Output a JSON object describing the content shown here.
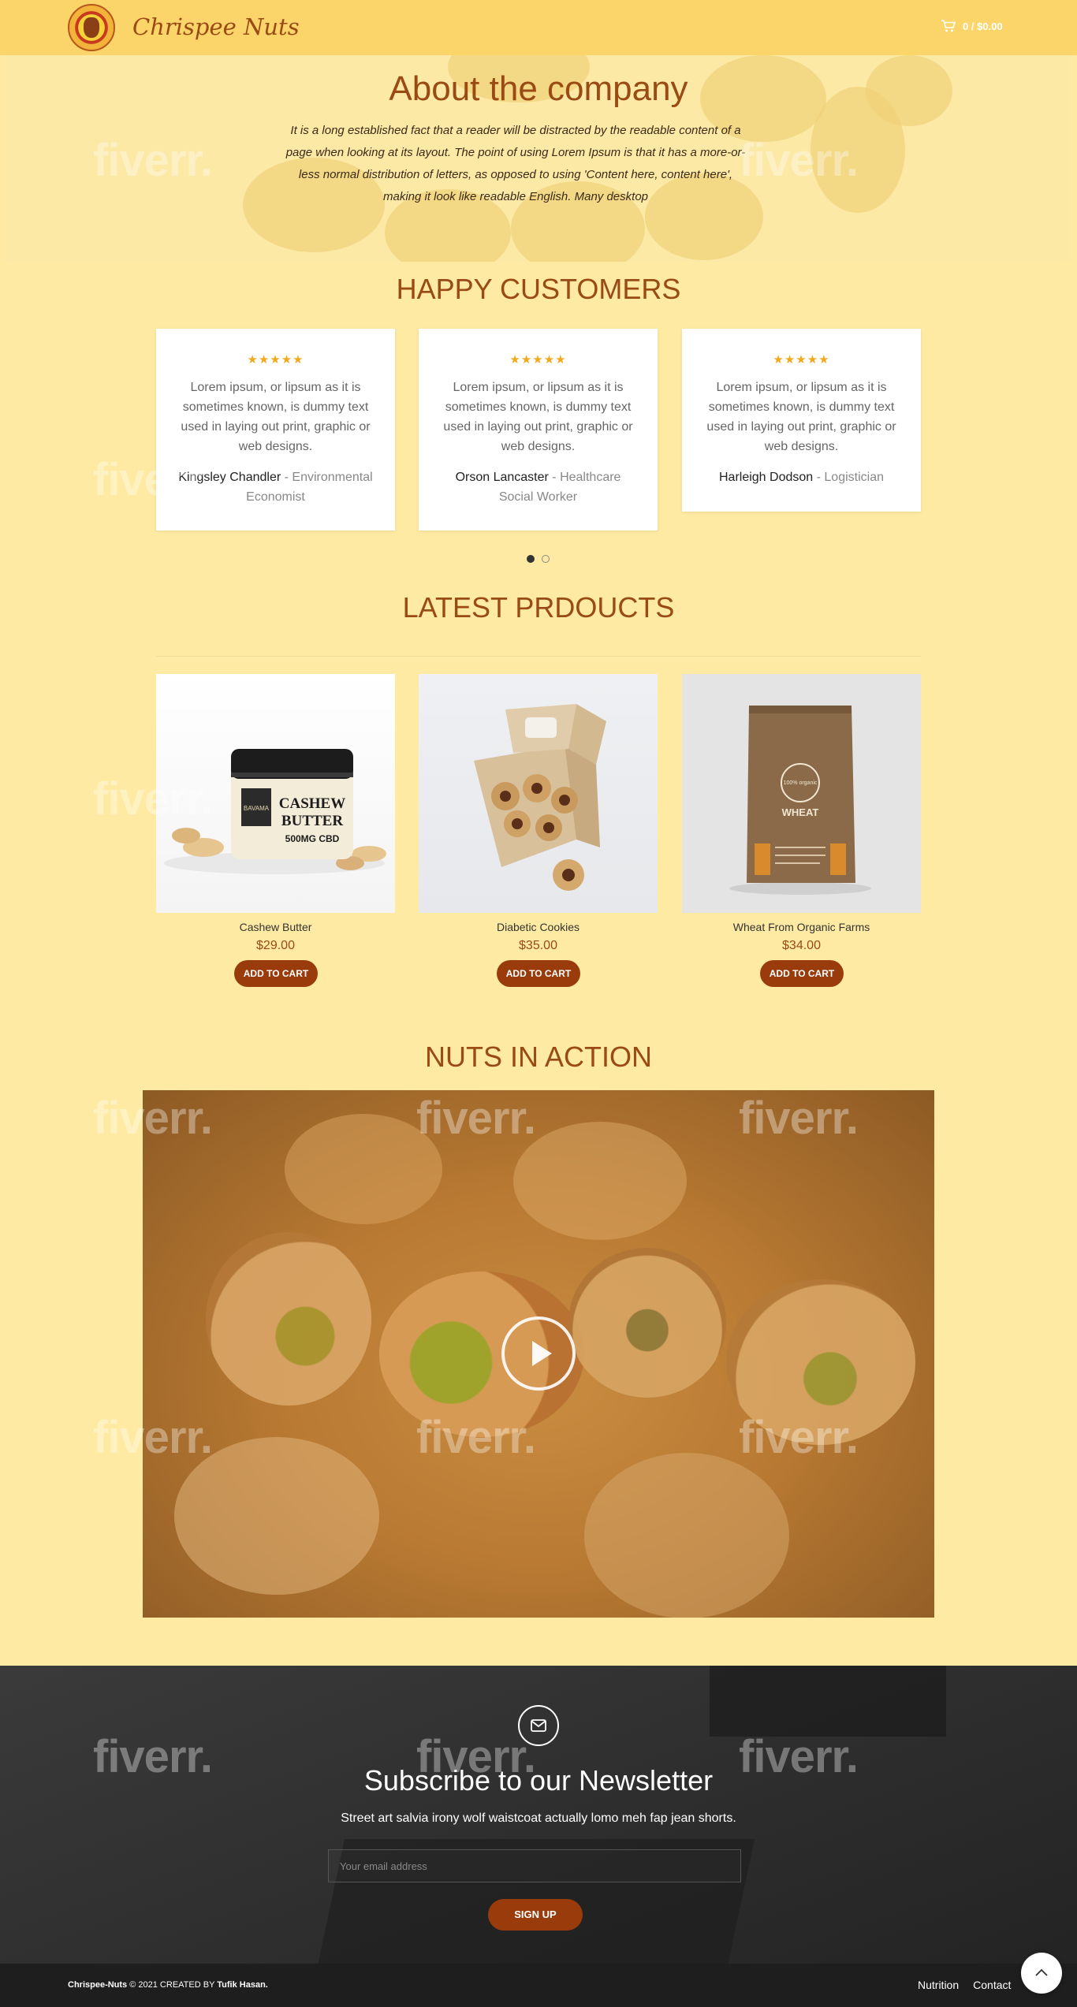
{
  "header": {
    "brand": "Chrispee Nuts",
    "cart_text": "0 / $0.00"
  },
  "about": {
    "title": "About the company",
    "text": "It is a long established fact that a reader will be distracted by the readable content of a page when looking at its layout. The point of using Lorem Ipsum is that it has a more-or-less normal distribution of letters, as opposed to using 'Content here, content here', making it look like readable English. Many desktop"
  },
  "testimonials": {
    "title": "HAPPY CUSTOMERS",
    "items": [
      {
        "stars": "★★★★★",
        "quote": "Lorem ipsum, or lipsum as it is sometimes known, is dummy text used in laying out print, graphic or web designs.",
        "name": "Kingsley Chandler",
        "role": "Environmental Economist"
      },
      {
        "stars": "★★★★★",
        "quote": "Lorem ipsum, or lipsum as it is sometimes known, is dummy text used in laying out print, graphic or web designs.",
        "name": "Orson Lancaster",
        "role": "Healthcare Social Worker"
      },
      {
        "stars": "★★★★★",
        "quote": "Lorem ipsum, or lipsum as it is sometimes known, is dummy text used in laying out print, graphic or web designs.",
        "name": "Harleigh Dodson",
        "role": "Logistician"
      }
    ]
  },
  "products": {
    "title": "LATEST PRDOUCTS",
    "items": [
      {
        "name": "Cashew Butter",
        "price": "$29.00",
        "button": "ADD TO CART",
        "jar_line1": "CASHEW",
        "jar_line2": "BUTTER",
        "jar_line3": "500MG CBD",
        "jar_brand": "BAVAMA"
      },
      {
        "name": "Diabetic Cookies",
        "price": "$35.00",
        "button": "ADD TO CART"
      },
      {
        "name": "Wheat From Organic Farms",
        "price": "$34.00",
        "button": "ADD TO CART",
        "bag_label": "WHEAT",
        "bag_badge": "100% organic"
      }
    ]
  },
  "video": {
    "title": "NUTS IN ACTION"
  },
  "newsletter": {
    "title": "Subscribe to our Newsletter",
    "subtitle": "Street art salvia irony wolf waistcoat actually lomo meh fap jean shorts.",
    "email_placeholder": "Your email address",
    "button": "SIGN UP"
  },
  "footer": {
    "brand": "Chrispee-Nuts",
    "copy": " © 2021 CREATED BY ",
    "author": "Tufik Hasan.",
    "links": [
      "Nutrition",
      "Contact"
    ]
  },
  "watermark": "fiverr."
}
